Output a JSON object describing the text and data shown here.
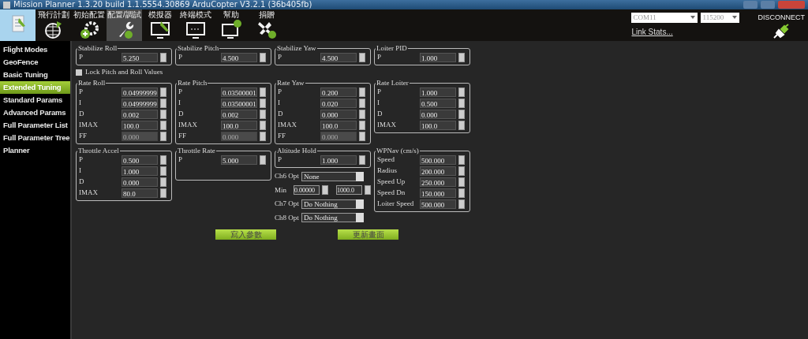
{
  "window": {
    "title": "Mission Planner 1.3.20 build 1.1.5554.30869 ArduCopter V3.2.1 (36b405fb)"
  },
  "toolbar": {
    "items": [
      {
        "kind": "data",
        "selected": false,
        "hovered": true
      },
      {
        "label": "飛行計劃",
        "kind": "plan",
        "selected": false,
        "hovered": false
      },
      {
        "label": "初始配置",
        "kind": "setup",
        "selected": false,
        "hovered": false
      },
      {
        "label": "配置/調試",
        "kind": "config",
        "selected": true,
        "hovered": false
      },
      {
        "label": "模擬器",
        "kind": "sim",
        "selected": false,
        "hovered": false
      },
      {
        "label": "終端模式",
        "kind": "terminal",
        "selected": false,
        "hovered": false
      },
      {
        "label": "幫助",
        "kind": "help",
        "selected": false,
        "hovered": false
      },
      {
        "label": "捐贈",
        "kind": "donate",
        "selected": false,
        "hovered": false
      }
    ]
  },
  "connection": {
    "port": "COM11",
    "baud": "115200",
    "link_stats": "Link Stats...",
    "disconnect": "DISCONNECT"
  },
  "sidebar": {
    "items": [
      {
        "label": "Flight Modes",
        "selected": false
      },
      {
        "label": "GeoFence",
        "selected": false
      },
      {
        "label": "Basic Tuning",
        "selected": false
      },
      {
        "label": "Extended Tuning",
        "selected": true
      },
      {
        "label": "Standard Params",
        "selected": false
      },
      {
        "label": "Advanced Params",
        "selected": false
      },
      {
        "label": "Full Parameter List",
        "selected": false
      },
      {
        "label": "Full Parameter Tree",
        "selected": false
      },
      {
        "label": "Planner",
        "selected": false
      }
    ]
  },
  "rows": [
    {
      "cells": [
        {
          "kind": "group",
          "title": "Stabilize Roll",
          "fields": [
            {
              "label": "P",
              "value": "5.250",
              "disabled": false
            }
          ]
        },
        {
          "kind": "group",
          "title": "Stabilize Pitch",
          "fields": [
            {
              "label": "P",
              "value": "4.500",
              "disabled": false
            }
          ]
        },
        {
          "kind": "group",
          "title": "Stabilize Yaw",
          "fields": [
            {
              "label": "P",
              "value": "4.500",
              "disabled": false
            }
          ]
        },
        {
          "kind": "group",
          "title": "Loiter PID",
          "fields": [
            {
              "label": "P",
              "value": "1.000",
              "disabled": false
            }
          ]
        }
      ]
    },
    {
      "checkbox": {
        "label": "Lock Pitch and Roll Values",
        "checked": false
      }
    },
    {
      "cells": [
        {
          "kind": "group",
          "title": "Rate Roll",
          "fields": [
            {
              "label": "P",
              "value": "0.04999999",
              "disabled": false
            },
            {
              "label": "I",
              "value": "0.04999999",
              "disabled": false
            },
            {
              "label": "D",
              "value": "0.002",
              "disabled": false
            },
            {
              "label": "IMAX",
              "value": "100.0",
              "disabled": false
            },
            {
              "label": "FF",
              "value": "0.000",
              "disabled": true
            }
          ]
        },
        {
          "kind": "group",
          "title": "Rate Pitch",
          "fields": [
            {
              "label": "P",
              "value": "0.03500001",
              "disabled": false
            },
            {
              "label": "I",
              "value": "0.03500001",
              "disabled": false
            },
            {
              "label": "D",
              "value": "0.002",
              "disabled": false
            },
            {
              "label": "IMAX",
              "value": "100.0",
              "disabled": false
            },
            {
              "label": "FF",
              "value": "0.000",
              "disabled": true
            }
          ]
        },
        {
          "kind": "group",
          "title": "Rate Yaw",
          "fields": [
            {
              "label": "P",
              "value": "0.200",
              "disabled": false
            },
            {
              "label": "I",
              "value": "0.020",
              "disabled": false
            },
            {
              "label": "D",
              "value": "0.000",
              "disabled": false
            },
            {
              "label": "IMAX",
              "value": "100.0",
              "disabled": false
            },
            {
              "label": "FF",
              "value": "0.000",
              "disabled": true
            }
          ]
        },
        {
          "kind": "group",
          "title": "Rate Loiter",
          "fields": [
            {
              "label": "P",
              "value": "1.000",
              "disabled": false
            },
            {
              "label": "I",
              "value": "0.500",
              "disabled": false
            },
            {
              "label": "D",
              "value": "0.000",
              "disabled": false
            },
            {
              "label": "IMAX",
              "value": "100.0",
              "disabled": false
            }
          ]
        }
      ]
    },
    {
      "cells": [
        {
          "kind": "group",
          "title": "Throttle Accel",
          "fields": [
            {
              "label": "P",
              "value": "0.500",
              "disabled": false
            },
            {
              "label": "I",
              "value": "1.000",
              "disabled": false
            },
            {
              "label": "D",
              "value": "0.000",
              "disabled": false
            },
            {
              "label": "IMAX",
              "value": "80.0",
              "disabled": false
            }
          ]
        },
        {
          "kind": "group",
          "title": "Throttle Rate",
          "fields": [
            {
              "label": "P",
              "value": "5.000",
              "disabled": false
            }
          ]
        },
        {
          "kind": "stack",
          "group": {
            "title": "Altitude Hold",
            "fields": [
              {
                "label": "P",
                "value": "1.000",
                "disabled": false
              }
            ]
          },
          "options": [
            {
              "kind": "select",
              "label": "Ch6 Opt",
              "value": "None"
            },
            {
              "kind": "range",
              "label": "Min",
              "min": "0.00000",
              "max": "1000.0"
            },
            {
              "kind": "select",
              "label": "Ch7 Opt",
              "value": "Do Nothing"
            },
            {
              "kind": "select",
              "label": "Ch8 Opt",
              "value": "Do Nothing"
            }
          ]
        },
        {
          "kind": "group",
          "title": "WPNav (cm/s)",
          "fields": [
            {
              "label": "Speed",
              "value": "500.000",
              "disabled": false
            },
            {
              "label": "Radius",
              "value": "200.000",
              "disabled": false
            },
            {
              "label": "Speed Up",
              "value": "250.000",
              "disabled": false
            },
            {
              "label": "Speed Dn",
              "value": "150.000",
              "disabled": false
            },
            {
              "label": "Loiter Speed",
              "value": "500.000",
              "disabled": false
            }
          ]
        }
      ]
    }
  ],
  "buttons": [
    {
      "label": "寫入參數"
    },
    {
      "label": "更新畫面"
    }
  ]
}
